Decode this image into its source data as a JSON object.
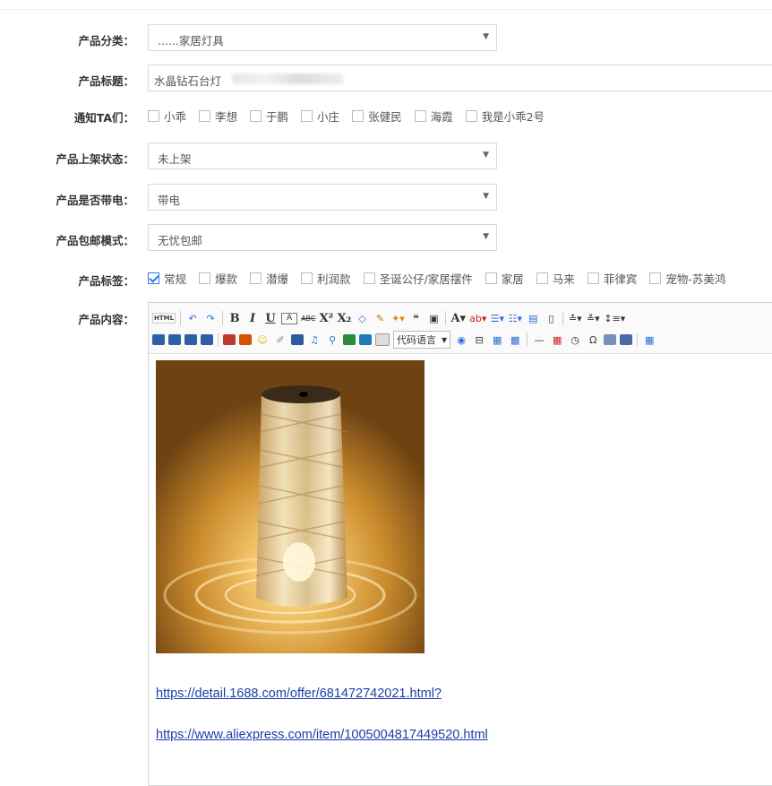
{
  "fields": {
    "category": {
      "label": "产品分类：",
      "value": "......家居灯具"
    },
    "title": {
      "label": "产品标题：",
      "value": "水晶钻石台灯"
    },
    "notify": {
      "label": "通知TA们：",
      "users": [
        {
          "name": "小乖",
          "checked": false
        },
        {
          "name": "李想",
          "checked": false
        },
        {
          "name": "于鹏",
          "checked": false
        },
        {
          "name": "小庄",
          "checked": false
        },
        {
          "name": "张健民",
          "checked": false
        },
        {
          "name": "海霞",
          "checked": false
        },
        {
          "name": "我是小乖2号",
          "checked": false
        }
      ]
    },
    "shelf_status": {
      "label": "产品上架状态：",
      "value": "未上架"
    },
    "electric": {
      "label": "产品是否带电：",
      "value": "带电"
    },
    "shipping": {
      "label": "产品包邮模式：",
      "value": "无忧包邮"
    },
    "tags": {
      "label": "产品标签：",
      "items": [
        {
          "name": "常规",
          "checked": true
        },
        {
          "name": "爆款",
          "checked": false
        },
        {
          "name": "潜爆",
          "checked": false
        },
        {
          "name": "利润款",
          "checked": false
        },
        {
          "name": "圣诞公仔/家居摆件",
          "checked": false
        },
        {
          "name": "家居",
          "checked": false
        },
        {
          "name": "马来",
          "checked": false
        },
        {
          "name": "菲律宾",
          "checked": false
        },
        {
          "name": "宠物-苏美鸿",
          "checked": false
        }
      ]
    },
    "content": {
      "label": "产品内容：",
      "toolbar": {
        "html_label": "HTML",
        "code_language": "代码语言"
      },
      "links": [
        "https://detail.1688.com/offer/681472742021.html?",
        "https://www.aliexpress.com/item/1005004817449520.html"
      ]
    }
  },
  "colors": {
    "link": "#1a3ea8",
    "checkbox_checked": "#2b7ce9",
    "border": "#d8d8d8"
  }
}
